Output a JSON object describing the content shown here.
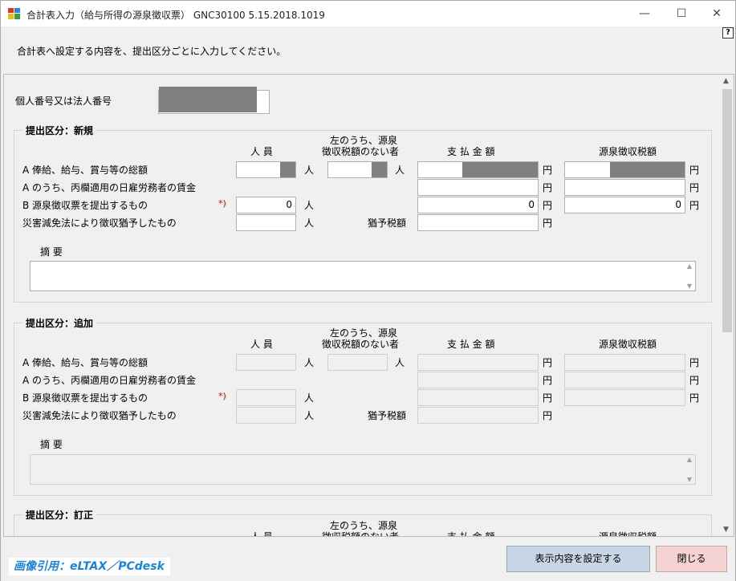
{
  "window": {
    "title": "合計表入力（給与所得の源泉徴収票） GNC30100 5.15.2018.1019",
    "minimize": "—",
    "maximize": "☐",
    "close": "✕"
  },
  "help": "?",
  "instruction": "合計表へ設定する内容を、提出区分ごとに入力してください。",
  "id_label": "個人番号又は法人番号",
  "headers": {
    "persons": "人 員",
    "no_tax_line1": "左のうち、源泉",
    "no_tax_line2": "徴収税額のない者",
    "payment": "支 払 金 額",
    "withholding": "源泉徴収税額"
  },
  "rows": {
    "a": "A 俸給、給与、賞与等の総額",
    "a_day": "A のうち、丙欄適用の日雇労務者の賃金",
    "b": "B 源泉徴収票を提出するもの",
    "disaster": "災害減免法により徴収猶予したもの"
  },
  "units": {
    "person": "人",
    "yen": "円"
  },
  "required": "*)",
  "deferred_tax": "猶予税額",
  "memo_label": "摘 要",
  "sections": [
    {
      "title": "提出区分：新規",
      "b_persons": "0",
      "b_payment": "0",
      "b_withholding": "0"
    },
    {
      "title": "提出区分：追加"
    },
    {
      "title": "提出区分：訂正"
    }
  ],
  "watermark": "画像引用：eLTAX／PCdesk",
  "buttons": {
    "apply": "表示内容を設定する",
    "close": "閉じる"
  },
  "colors": {
    "apply_bg": "#c7d5e4",
    "close_bg": "#f6d3d3",
    "mask": "#808080",
    "required": "#d00000",
    "watermark": "#1c84d8"
  }
}
